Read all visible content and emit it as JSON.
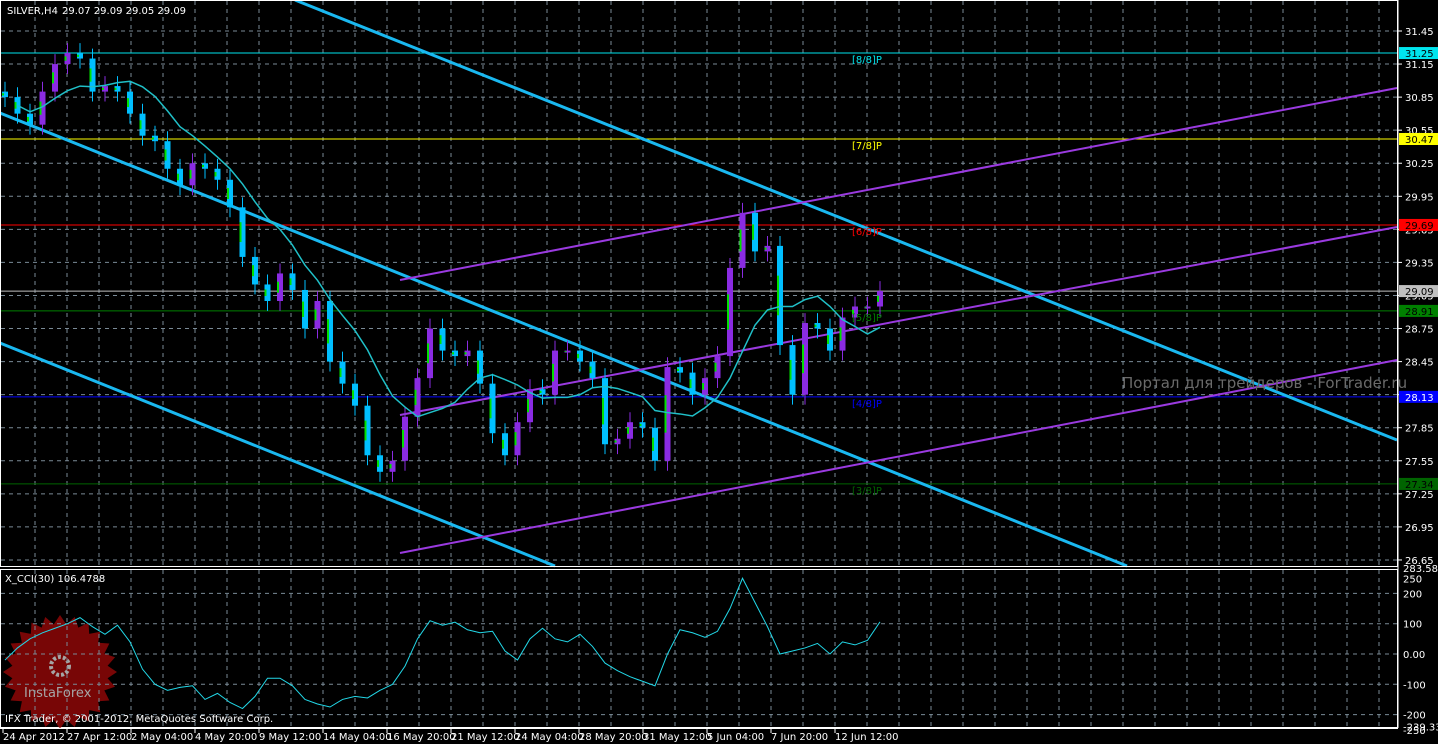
{
  "header": {
    "symbol": "SILVER,H4",
    "ohlc": "29.07 29.09 29.05 29.09"
  },
  "indicator": {
    "label": "X_CCI(30) 106.4788"
  },
  "copyright": "IFX Trader, © 2001-2012, MetaQuotes Software Corp.",
  "watermark": "Портал для трейдеров - ForTrader.ru",
  "logo": {
    "text": "InstaForex"
  },
  "colors": {
    "bull": "#8a2be2",
    "bear": "#00bfff",
    "wick_bull": "#8a2be2",
    "ma": "#20c0c8",
    "cci": "#22d8e8",
    "grid": "#7a8a96",
    "channel": "#1ab8f0",
    "pitch": "#9a3ae0"
  },
  "chart_data": [
    {
      "type": "candlestick",
      "title": "SILVER,H4",
      "ylim": [
        26.55,
        31.6
      ],
      "yticks": [
        "31.45",
        "31.15",
        "30.85",
        "30.55",
        "30.25",
        "29.95",
        "29.65",
        "29.35",
        "29.05",
        "28.75",
        "28.45",
        "28.15",
        "27.85",
        "27.55",
        "27.25",
        "26.95",
        "26.65"
      ],
      "xticks": [
        "24 Apr 2012",
        "27 Apr 12:00",
        "2 May 04:00",
        "4 May 20:00",
        "9 May 12:00",
        "14 May 04:00",
        "16 May 20:00",
        "21 May 12:00",
        "24 May 04:00",
        "28 May 20:00",
        "31 May 12:00",
        "5 Jun 04:00",
        "7 Jun 20:00",
        "12 Jun 12:00"
      ],
      "closes": [
        30.85,
        30.7,
        30.6,
        30.9,
        31.15,
        31.25,
        31.2,
        30.9,
        30.95,
        30.9,
        30.7,
        30.5,
        30.45,
        30.2,
        30.05,
        30.25,
        30.2,
        30.1,
        29.85,
        29.4,
        29.15,
        29.0,
        29.25,
        29.1,
        28.75,
        29.0,
        28.45,
        28.25,
        28.05,
        27.6,
        27.45,
        27.55,
        27.95,
        28.3,
        28.75,
        28.55,
        28.5,
        28.55,
        28.25,
        27.8,
        27.6,
        27.9,
        28.2,
        28.15,
        28.55,
        28.55,
        28.45,
        28.3,
        27.7,
        27.75,
        27.9,
        27.85,
        27.55,
        28.4,
        28.35,
        28.15,
        28.3,
        28.5,
        29.3,
        29.8,
        29.45,
        29.5,
        28.6,
        28.15,
        28.8,
        28.75,
        28.55,
        28.85,
        28.95,
        28.95,
        29.09
      ],
      "ma_period": 8,
      "levels": [
        {
          "value": 31.25,
          "price_label": "31.25",
          "tag": "[8/8]P",
          "color": "#00e5ee",
          "label_fg": "#000"
        },
        {
          "value": 30.47,
          "price_label": "30.47",
          "tag": "[7/8]P",
          "color": "#ffff00",
          "label_fg": "#000"
        },
        {
          "value": 29.69,
          "price_label": "29.69",
          "tag": "[6/8]P",
          "color": "#ff0000",
          "label_fg": "#000"
        },
        {
          "value": 29.09,
          "price_label": "29.09",
          "tag": "",
          "color": "#c0c0c0",
          "label_fg": "#000"
        },
        {
          "value": 28.91,
          "price_label": "28.91",
          "tag": "[5/8]P",
          "color": "#008000",
          "label_fg": "#000"
        },
        {
          "value": 28.13,
          "price_label": "28.13",
          "tag": "[4/8]P",
          "color": "#0000ff",
          "label_fg": "#fff"
        },
        {
          "value": 27.34,
          "price_label": "27.34",
          "tag": "[3/8]P",
          "color": "#006400",
          "label_fg": "#000"
        }
      ]
    },
    {
      "type": "line",
      "title": "X_CCI(30)",
      "ylim": [
        -239.334,
        283.584
      ],
      "yticks": [
        "283.584",
        "250",
        "200",
        "100",
        "0.00",
        "-100",
        "-200",
        "-239.334",
        "-250"
      ],
      "values": [
        -20,
        20,
        50,
        70,
        85,
        100,
        120,
        90,
        65,
        95,
        40,
        -50,
        -100,
        -120,
        -110,
        -105,
        -150,
        -130,
        -160,
        -180,
        -140,
        -80,
        -80,
        -105,
        -150,
        -165,
        -175,
        -150,
        -140,
        -145,
        -120,
        -100,
        -40,
        50,
        110,
        95,
        105,
        80,
        70,
        75,
        10,
        -20,
        50,
        85,
        50,
        40,
        65,
        25,
        -30,
        -55,
        -75,
        -90,
        -105,
        0,
        80,
        70,
        55,
        75,
        150,
        250,
        170,
        90,
        0,
        10,
        20,
        35,
        0,
        40,
        30,
        45,
        106
      ]
    }
  ]
}
